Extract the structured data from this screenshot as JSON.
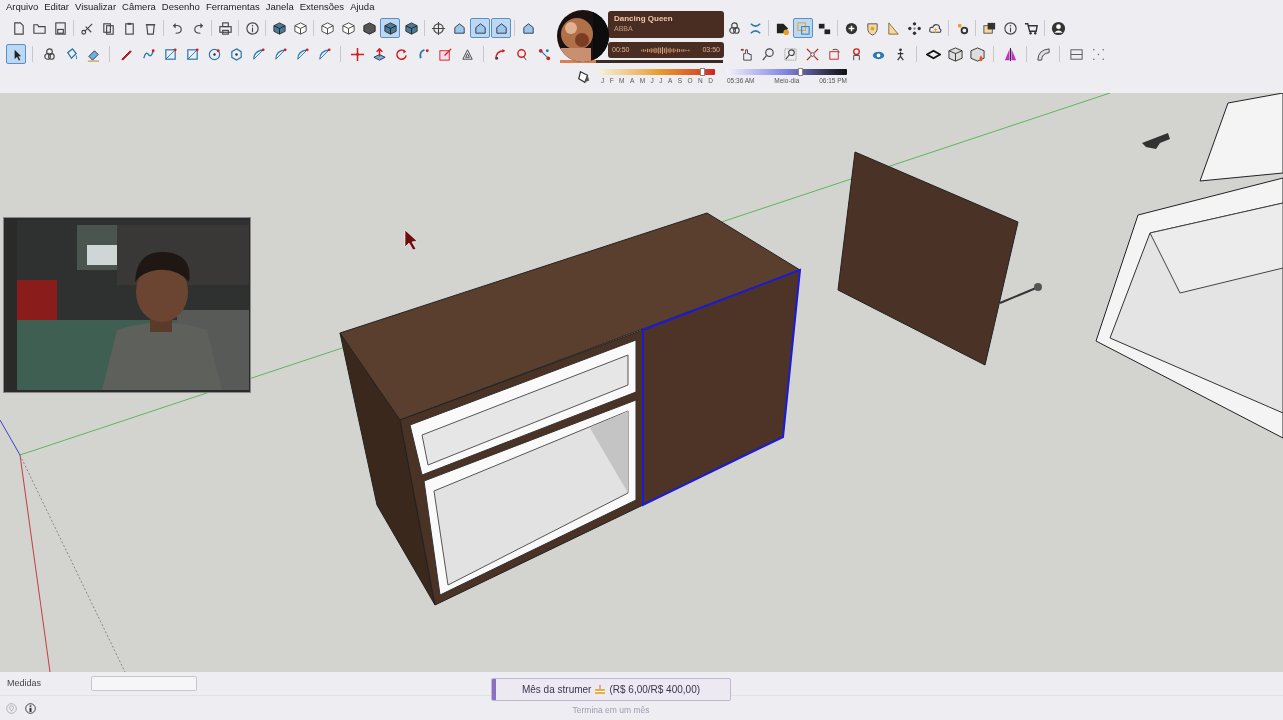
{
  "menu": [
    "Arquivo",
    "Editar",
    "Visualizar",
    "Câmera",
    "Desenho",
    "Ferramentas",
    "Janela",
    "Extensões",
    "Ajuda"
  ],
  "toolbar_rows": [
    {
      "buttons": [
        {
          "selected": false
        },
        {
          "selected": false
        },
        {
          "selected": false
        },
        {
          "selected": false
        },
        {
          "selected": false
        },
        {
          "selected": false
        },
        {
          "selected": false
        },
        {
          "selected": false
        },
        {
          "selected": false
        },
        {
          "selected": false
        },
        {
          "selected": false
        },
        {
          "selected": false
        },
        {
          "selected": false
        },
        {
          "selected": false
        },
        {
          "selected": false
        },
        {
          "selected": false
        },
        {
          "selected": true
        },
        {
          "selected": false
        },
        {
          "selected": false
        },
        {
          "selected": false
        },
        {
          "selected": true
        },
        {
          "selected": true
        },
        {
          "selected": false
        },
        {
          "selected": false
        },
        {
          "selected": false
        },
        {
          "selected": false
        },
        {
          "selected": true
        },
        {
          "selected": false
        },
        {
          "selected": false
        },
        {
          "selected": false
        },
        {
          "selected": false
        },
        {
          "selected": false
        },
        {
          "selected": false
        },
        {
          "selected": false
        },
        {
          "selected": false
        },
        {
          "selected": false
        },
        {
          "selected": false
        },
        {
          "selected": false
        }
      ]
    },
    {
      "buttons": [
        {
          "selected": true
        },
        {
          "selected": false
        },
        {
          "selected": false
        },
        {
          "selected": false
        },
        {
          "selected": false
        },
        {
          "selected": false
        },
        {
          "selected": false
        },
        {
          "selected": false
        },
        {
          "selected": false
        },
        {
          "selected": false
        },
        {
          "selected": false
        },
        {
          "selected": false
        },
        {
          "selected": false
        },
        {
          "selected": false
        },
        {
          "selected": false
        },
        {
          "selected": false
        },
        {
          "selected": false
        },
        {
          "selected": false
        },
        {
          "selected": false
        },
        {
          "selected": false
        },
        {
          "selected": false
        },
        {
          "selected": false
        },
        {
          "selected": false
        },
        {
          "selected": false
        },
        {
          "selected": false
        },
        {
          "selected": false
        },
        {
          "selected": false
        },
        {
          "selected": false
        },
        {
          "selected": false
        },
        {
          "selected": false
        },
        {
          "selected": false
        },
        {
          "selected": false
        },
        {
          "selected": false
        },
        {
          "selected": false
        },
        {
          "selected": false
        },
        {
          "selected": false
        },
        {
          "selected": false
        },
        {
          "selected": false
        }
      ]
    }
  ],
  "shadows": {
    "months": [
      "J",
      "F",
      "M",
      "A",
      "M",
      "J",
      "J",
      "A",
      "S",
      "O",
      "N",
      "D"
    ],
    "month_slider": {
      "level": 0.9
    },
    "time_slider": {
      "level": 0.62
    },
    "time_labels": [
      "05:36 AM",
      "Meio-dia",
      "06:15 PM"
    ]
  },
  "music": {
    "title": "Dancing Queen",
    "artist": "ABBA",
    "elapsed": "00:50",
    "duration": "03:50",
    "level": 0.22
  },
  "measurements": {
    "label": "Medidas"
  },
  "goal": {
    "name": "Mês da strumer",
    "amount": "(R$ 6,00/R$ 400,00)",
    "level": 0.015,
    "subtitle": "Termina em um mês"
  }
}
